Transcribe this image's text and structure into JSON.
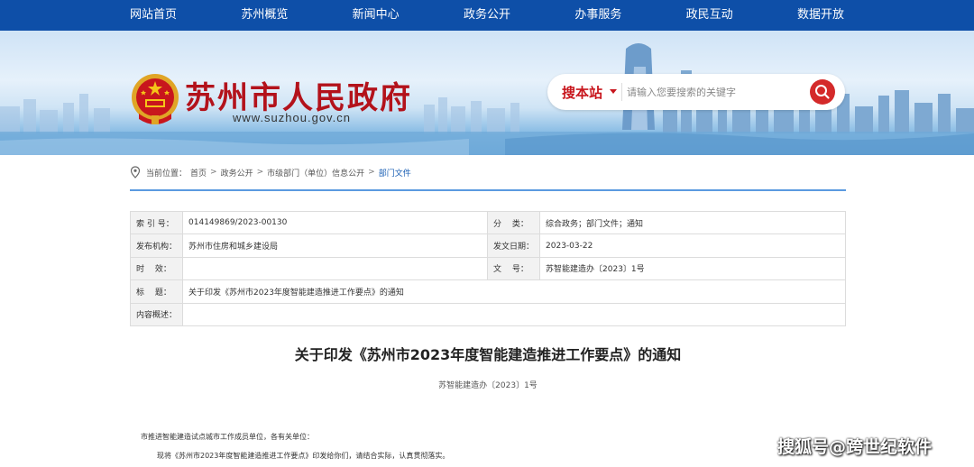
{
  "nav": {
    "items": [
      "网站首页",
      "苏州概览",
      "新闻中心",
      "政务公开",
      "办事服务",
      "政民互动",
      "数据开放"
    ]
  },
  "header": {
    "site_title": "苏州市人民政府",
    "site_url": "www.suzhou.gov.cn",
    "emblem_icon": "national-emblem-icon"
  },
  "search": {
    "label": "搜本站",
    "placeholder": "请输入您要搜索的关键字",
    "button_icon": "search-icon",
    "accent_color": "#d42a2a"
  },
  "breadcrumb": {
    "prefix": "当前位置：",
    "items": [
      "首页",
      "政务公开",
      "市级部门（单位）信息公开",
      "部门文件"
    ],
    "separator": ">"
  },
  "info_table": {
    "rows": [
      {
        "k1": "索 引 号：",
        "v1": "014149869/2023-00130",
        "k2": "分　 类：",
        "v2": "综合政务；部门文件；通知"
      },
      {
        "k1": "发布机构：",
        "v1": "苏州市住房和城乡建设局",
        "k2": "发文日期：",
        "v2": "2023-03-22"
      },
      {
        "k1": "时　 效：",
        "v1": "",
        "k2": "文　 号：",
        "v2": "苏智能建造办〔2023〕1号"
      },
      {
        "k1": "标　 题：",
        "v1": "关于印发《苏州市2023年度智能建造推进工作要点》的通知"
      },
      {
        "k1": "内容概述：",
        "v1": ""
      }
    ]
  },
  "document": {
    "title": "关于印发《苏州市2023年度智能建造推进工作要点》的通知",
    "number": "苏智能建造办〔2023〕1号",
    "para1": "市推进智能建造试点城市工作成员单位，各有关单位：",
    "para2": "现将《苏州市2023年度智能建造推进工作要点》印发给你们，请结合实际，认真贯彻落实。"
  },
  "watermark": "搜狐号@跨世纪软件",
  "colors": {
    "nav_bg": "#0e4fa8",
    "title_red": "#b3121b",
    "breadcrumb_current": "#1a5fb4"
  }
}
